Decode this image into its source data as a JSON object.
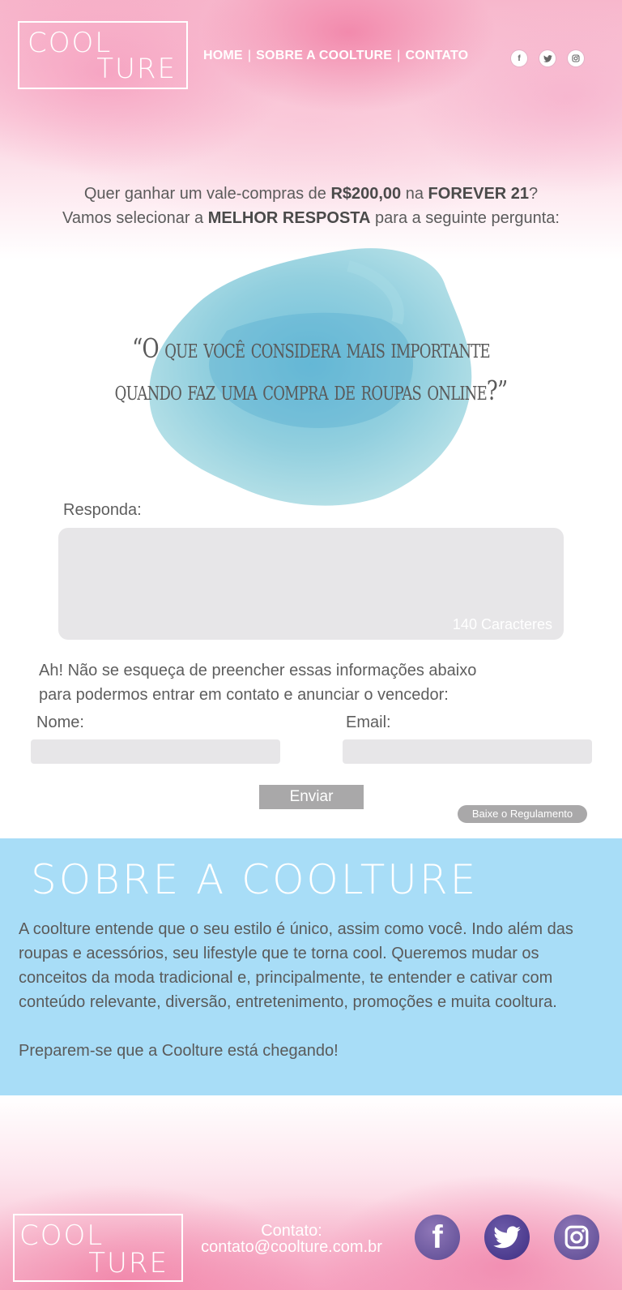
{
  "logo": {
    "line1": "COOL",
    "line2": "TURE"
  },
  "nav": {
    "home": "HOME",
    "about": "SOBRE A COOLTURE",
    "contact": "CONTATO",
    "separator": "|"
  },
  "social_icons": [
    "facebook-icon",
    "twitter-icon",
    "instagram-icon"
  ],
  "intro": {
    "line1_a": "Quer ganhar um vale-compras de ",
    "line1_amount": "R$200,00",
    "line1_b": " na ",
    "line1_store": "FOREVER 21",
    "line1_c": "?",
    "line2_a": "Vamos selecionar a ",
    "line2_best": "MELHOR RESPOSTA",
    "line2_b": " para a seguinte pergunta:"
  },
  "question": {
    "line1": "“O que você considera mais importante",
    "line2": "quando faz uma compra de roupas online?”"
  },
  "form": {
    "answer_label": "Responda:",
    "answer_counter": "140 Caracteres",
    "answer_value": "",
    "reminder_line1": "Ah! Não se esqueça de preencher essas informações abaixo",
    "reminder_line2": "para podermos entrar em contato e anunciar o vencedor:",
    "name_label": "Nome:",
    "name_value": "",
    "email_label": "Email:",
    "email_value": "",
    "submit_label": "Enviar",
    "rules_label": "Baixe o Regulamento"
  },
  "about": {
    "title": "SOBRE A COOLTURE",
    "paragraph1": "A coolture entende que o seu estilo é único, assim como você. Indo além das roupas e acessórios, seu lifestyle que te torna cool. Queremos mudar os conceitos da moda tradicional e, principalmente, te entender e cativar com conteúdo relevante, diversão, entretenimento, promoções e muita cooltura.",
    "paragraph2": "Preparem-se que a Coolture está chegando!"
  },
  "footer": {
    "contact_label": "Contato:",
    "contact_email": "contato@coolture.com.br"
  },
  "colors": {
    "pink": "#f7b7cc",
    "blue_section": "#a8ddf7",
    "splash_blue": "#7cc7d8",
    "input_gray": "#e7e6e8",
    "button_gray": "#a9a8a9",
    "social_purple": "#6c5aa8"
  }
}
